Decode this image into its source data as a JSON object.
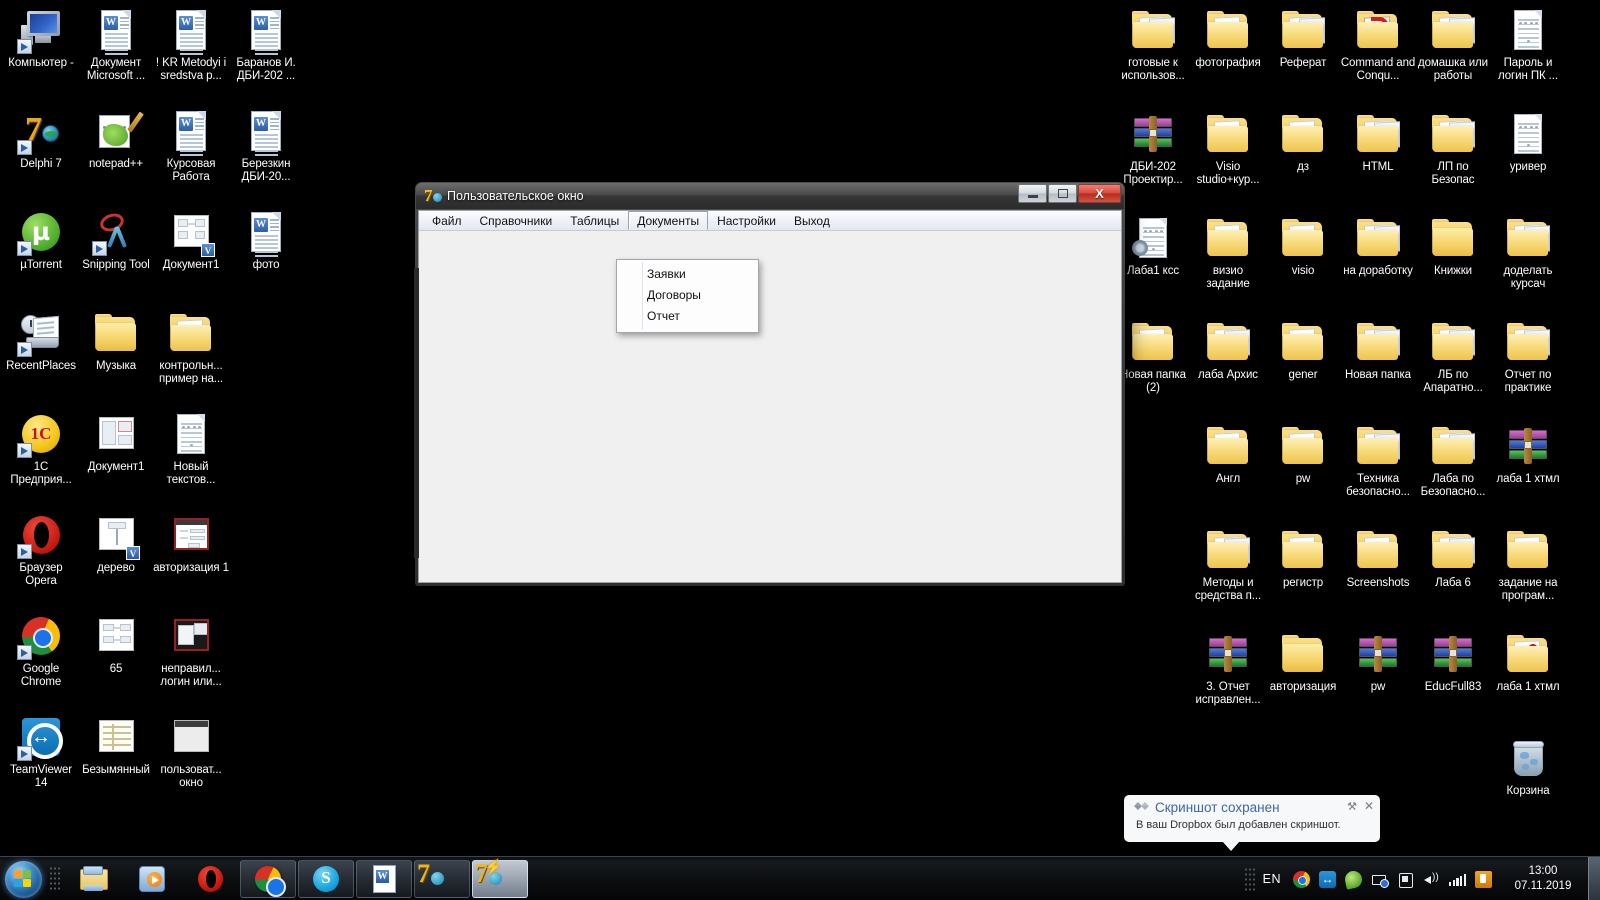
{
  "desktop": {
    "left_icons": [
      {
        "label": "Компьютер -",
        "type": "computer",
        "shortcut": true
      },
      {
        "label": "Документ Microsoft ...",
        "type": "doc-stacked",
        "shortcut": false
      },
      {
        "label": "! KR Metodyi i sredstva p...",
        "type": "doc-word",
        "shortcut": false
      },
      {
        "label": "Баранов И. ДБИ-202 ...",
        "type": "doc-word",
        "shortcut": false
      },
      {
        "label": "Delphi 7",
        "type": "delphi",
        "shortcut": true
      },
      {
        "label": "notepad++",
        "type": "notepadpp",
        "shortcut": false
      },
      {
        "label": "Курсовая Работа",
        "type": "doc-stacked",
        "shortcut": false
      },
      {
        "label": "Березкин ДБИ-20...",
        "type": "doc-word",
        "shortcut": false
      },
      {
        "label": "µTorrent",
        "type": "utorrent",
        "shortcut": true
      },
      {
        "label": "Snipping Tool",
        "type": "snipping",
        "shortcut": true
      },
      {
        "label": "Документ1",
        "type": "visio-thumb",
        "shortcut": false
      },
      {
        "label": "фото",
        "type": "doc-stacked",
        "shortcut": false
      },
      {
        "label": "RecentPlaces",
        "type": "recent",
        "shortcut": true
      },
      {
        "label": "Музыка",
        "type": "folder-music",
        "shortcut": false
      },
      {
        "label": "контрольн... пример на...",
        "type": "folder-plain",
        "shortcut": false
      },
      {
        "label": "1C Предприя...",
        "type": "onec",
        "shortcut": true
      },
      {
        "label": "Документ1",
        "type": "thumb-sheet",
        "shortcut": false
      },
      {
        "label": "Новый текстов...",
        "type": "txt",
        "shortcut": false
      },
      {
        "label": "Браузер Opera",
        "type": "opera",
        "shortcut": true
      },
      {
        "label": "дерево",
        "type": "visio-thumb2",
        "shortcut": false
      },
      {
        "label": "авторизация 1",
        "type": "thumb-dialog",
        "shortcut": false
      },
      {
        "label": "Google Chrome",
        "type": "chrome",
        "shortcut": true
      },
      {
        "label": "65",
        "type": "thumb-diagram",
        "shortcut": false
      },
      {
        "label": "неправил... логин или...",
        "type": "thumb-dark",
        "shortcut": false
      },
      {
        "label": "TeamViewer 14",
        "type": "teamviewer",
        "shortcut": true
      },
      {
        "label": "Безымянный",
        "type": "thumb-table",
        "shortcut": false
      },
      {
        "label": "пользоват... окно",
        "type": "thumb-window",
        "shortcut": false
      }
    ],
    "right_icons": [
      {
        "label": "готовые к использов...",
        "type": "folder-doc"
      },
      {
        "label": "фотография",
        "type": "folder-doc2"
      },
      {
        "label": "Реферат",
        "type": "folder-doc"
      },
      {
        "label": "Command and Conqu...",
        "type": "folder-cnc"
      },
      {
        "label": "домашка или работы",
        "type": "folder-doc"
      },
      {
        "label": "Пароль и логин ПК ...",
        "type": "txt"
      },
      {
        "label": "ДБИ-202 Проектир...",
        "type": "rar"
      },
      {
        "label": "Visio studio+кур...",
        "type": "folder-plain"
      },
      {
        "label": "дз",
        "type": "folder-plain"
      },
      {
        "label": "HTML",
        "type": "folder-doc"
      },
      {
        "label": "ЛП по Безопас",
        "type": "folder-doc"
      },
      {
        "label": "уривер",
        "type": "txt"
      },
      {
        "label": "Лаба1 ксс",
        "type": "txt-gear"
      },
      {
        "label": "визио задание",
        "type": "folder-doc2"
      },
      {
        "label": "visio",
        "type": "folder-plain"
      },
      {
        "label": "на доработку",
        "type": "folder-doc"
      },
      {
        "label": "Книжки",
        "type": "folder-closed"
      },
      {
        "label": "доделать курсач",
        "type": "folder-doc"
      },
      {
        "label": "Новая папка (2)",
        "type": "folder-plain"
      },
      {
        "label": "лаба Архис",
        "type": "folder-doc"
      },
      {
        "label": "gener",
        "type": "folder-plain"
      },
      {
        "label": "Новая папка",
        "type": "folder-doc"
      },
      {
        "label": "ЛБ по Апаратно...",
        "type": "folder-doc"
      },
      {
        "label": "Отчет по практике",
        "type": "folder-doc"
      },
      {
        "label": "Англ",
        "type": "folder-plain"
      },
      {
        "label": "pw",
        "type": "folder-plain"
      },
      {
        "label": "Техника безопасно...",
        "type": "folder-doc"
      },
      {
        "label": "Лаба по Безопасно...",
        "type": "folder-doc"
      },
      {
        "label": "лаба 1 хтмл",
        "type": "rar"
      },
      {
        "label": "Методы и средства п...",
        "type": "folder-doc"
      },
      {
        "label": "регистр",
        "type": "folder-plain"
      },
      {
        "label": "Screenshots",
        "type": "folder-doc2"
      },
      {
        "label": "Лаба 6",
        "type": "folder-doc"
      },
      {
        "label": "задание на програм...",
        "type": "folder-plain"
      },
      {
        "label": "3. Отчет исправлен...",
        "type": "rar"
      },
      {
        "label": "авторизация",
        "type": "folder-closed"
      },
      {
        "label": "pw",
        "type": "rar"
      },
      {
        "label": "EducFull83",
        "type": "rar"
      },
      {
        "label": "лаба 1 хтмл",
        "type": "folder-red"
      },
      {
        "label": "Корзина",
        "type": "recycle-bin"
      }
    ]
  },
  "window": {
    "title": "Пользовательское окно",
    "icon_name": "delphi-app-icon",
    "buttons": {
      "minimize": "–",
      "maximize": "□",
      "close": "X"
    },
    "menubar": [
      {
        "label": "Файл",
        "active": false
      },
      {
        "label": "Справочники",
        "active": false
      },
      {
        "label": "Таблицы",
        "active": false
      },
      {
        "label": "Документы",
        "active": true
      },
      {
        "label": "Настройки",
        "active": false
      },
      {
        "label": "Выход",
        "active": false
      }
    ],
    "dropdown": {
      "owner": "Документы",
      "items": [
        "Заявки",
        "Договоры",
        "Отчет"
      ]
    }
  },
  "toast": {
    "icon_name": "dropbox-icon",
    "title": "Скриншот сохранен",
    "body": "В ваш Dropbox был добавлен скриншот.",
    "settings_icon": "⚒",
    "close_icon": "✕"
  },
  "taskbar": {
    "start_label": "Пуск",
    "quick_launch": [
      {
        "name": "explorer-icon",
        "label": "Проводник"
      },
      {
        "name": "media-player-icon",
        "label": "Windows Media Player"
      },
      {
        "name": "opera-icon",
        "label": "Opera"
      }
    ],
    "windows": [
      {
        "name": "chrome-icon",
        "label": "Google Chrome",
        "active": false
      },
      {
        "name": "skype-icon",
        "label": "Skype",
        "active": false
      },
      {
        "name": "word-icon",
        "label": "Microsoft Word",
        "active": false
      },
      {
        "name": "delphi-icon",
        "label": "Delphi 7",
        "active": false
      },
      {
        "name": "delphi-app-icon",
        "label": "Пользовательское окно",
        "active": true
      }
    ],
    "tray": {
      "language": "EN",
      "icons": [
        {
          "name": "chrome-tray-icon"
        },
        {
          "name": "teamviewer-tray-icon"
        },
        {
          "name": "dropbox-tray-icon"
        },
        {
          "name": "network-tray-icon"
        },
        {
          "name": "safely-remove-hardware-icon"
        },
        {
          "name": "volume-icon"
        },
        {
          "name": "signal-strength-icon"
        },
        {
          "name": "update-icon"
        }
      ]
    },
    "clock": {
      "time": "13:00",
      "date": "07.11.2019"
    }
  }
}
